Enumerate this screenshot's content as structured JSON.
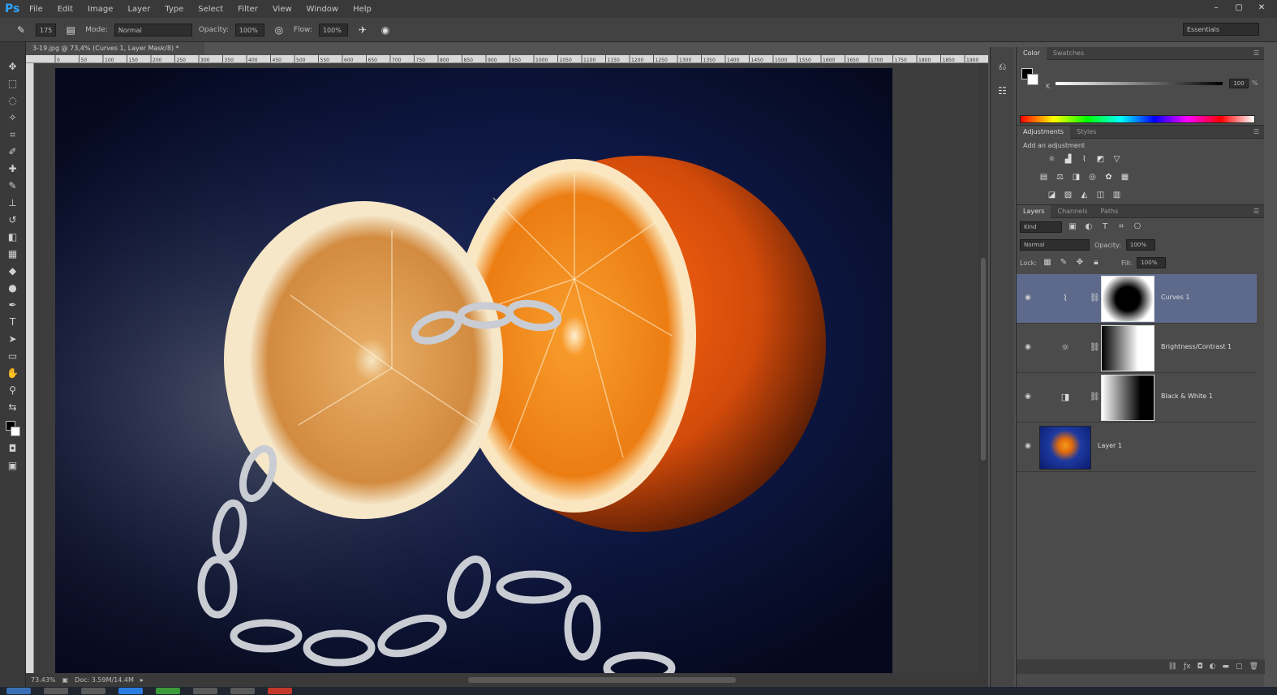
{
  "app": {
    "logo": "Ps",
    "menus": [
      "File",
      "Edit",
      "Image",
      "Layer",
      "Type",
      "Select",
      "Filter",
      "View",
      "Window",
      "Help"
    ],
    "window_controls": [
      "–",
      "▢",
      "✕"
    ]
  },
  "options_bar": {
    "brush_size": "175",
    "mode_label": "Mode:",
    "mode_value": "Normal",
    "opacity_label": "Opacity:",
    "opacity_value": "100%",
    "flow_label": "Flow:",
    "flow_value": "100%",
    "workspace": "Essentials"
  },
  "document": {
    "tab_title": "3-19.jpg @ 73,4% (Curves 1, Layer Mask/8) *",
    "ruler_ticks": [
      "0",
      "50",
      "100",
      "150",
      "200",
      "250",
      "300",
      "350",
      "400",
      "450",
      "500",
      "550",
      "600",
      "650",
      "700",
      "750",
      "800",
      "850",
      "900",
      "950",
      "1000",
      "1050",
      "1100",
      "1150",
      "1200",
      "1250",
      "1300",
      "1350",
      "1400",
      "1450",
      "1500",
      "1550",
      "1600",
      "1650",
      "1700",
      "1750",
      "1800",
      "1850",
      "1900",
      "1950"
    ],
    "zoom": "73.43%",
    "doc_info": "Doc: 3.59M/14.4M"
  },
  "colors": {
    "accent": "#2fa3ff",
    "selected_layer": "#5d6a8c",
    "orange": "#f28a1a"
  },
  "color_panel": {
    "tabs": [
      "Color",
      "Swatches"
    ],
    "channel": "K",
    "value": "100",
    "unit": "%"
  },
  "adjustments_panel": {
    "tabs": [
      "Adjustments",
      "Styles"
    ],
    "title": "Add an adjustment",
    "row1_icons": [
      "brightness-icon",
      "levels-icon",
      "curves-icon",
      "exposure-icon",
      "vibrance-icon"
    ],
    "row2_icons": [
      "hue-sat-icon",
      "color-balance-icon",
      "black-white-icon",
      "photo-filter-icon",
      "channel-mixer-icon",
      "color-lookup-icon"
    ],
    "row3_icons": [
      "invert-icon",
      "posterize-icon",
      "threshold-icon",
      "selective-color-icon",
      "gradient-map-icon"
    ]
  },
  "layers_panel": {
    "tabs": [
      "Layers",
      "Channels",
      "Paths"
    ],
    "filter_kind": "Kind",
    "blend_mode": "Normal",
    "opacity_label": "Opacity:",
    "opacity_value": "100%",
    "lock_label": "Lock:",
    "fill_label": "Fill:",
    "fill_value": "100%",
    "layers": [
      {
        "name": "Curves 1",
        "type": "curves",
        "selected": true
      },
      {
        "name": "Brightness/Contrast 1",
        "type": "brightness",
        "selected": false
      },
      {
        "name": "Black & White 1",
        "type": "bw",
        "selected": false
      },
      {
        "name": "Layer 1",
        "type": "pixel",
        "selected": false
      }
    ]
  }
}
